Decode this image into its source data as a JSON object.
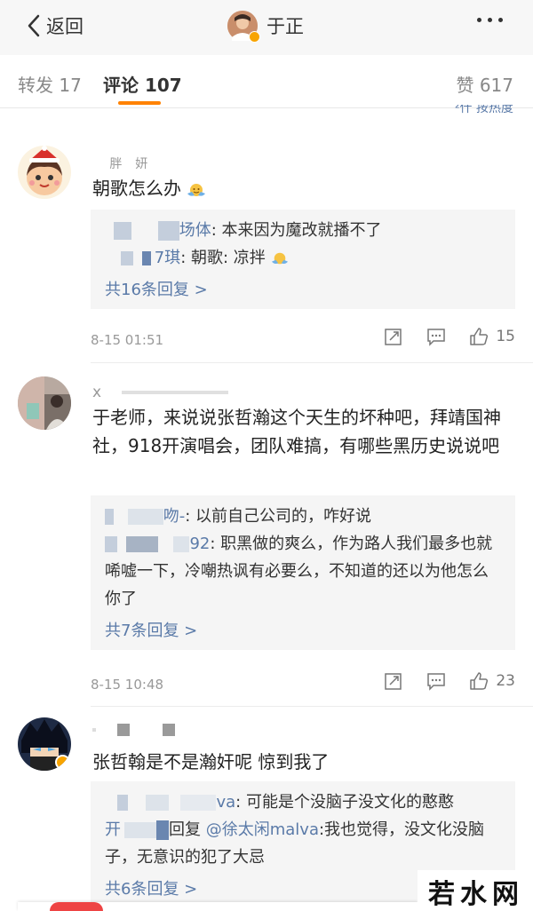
{
  "nav": {
    "back_label": "返回",
    "title": "于正"
  },
  "tabs": [
    {
      "label": "转发 17"
    },
    {
      "label": "评论 107"
    },
    {
      "label": "赞 617"
    }
  ],
  "cutoff_text": "²什 按热度",
  "comments": [
    {
      "username": "   胖  妍",
      "text": "朝歌怎么办",
      "emoji": "hug-emoji",
      "replies": [
        {
          "name": "场体",
          "text": ": 本来因为魔改就播不了"
        },
        {
          "name": "7琪",
          "text": ": 朝歌: 凉拌"
        }
      ],
      "more": "共16条回复 >",
      "date": "8-15 01:51",
      "likes": "15"
    },
    {
      "username": "x",
      "text": "于老师，来说说张哲瀚这个天生的坏种吧，拜靖国神社，918开演唱会，团队难搞，有哪些黑历史说说吧",
      "replies": [
        {
          "name": "吻-",
          "text": ": 以前自己公司的，咋好说"
        },
        {
          "name": "92",
          "text": ": 职黑做的爽么，作为路人我们最多也就唏嘘一下，冷嘲热讽有必要么，不知道的还以为他怎么你了"
        }
      ],
      "more": "共7条回复 >",
      "date": "8-15 10:48",
      "likes": "23"
    },
    {
      "username": "",
      "text": "张哲翰是不是瀚奸呢 惊到我了",
      "replies": [
        {
          "name": "va",
          "text": ": 可能是个没脑子没文化的憨憨"
        },
        {
          "name": "开",
          "text": "回复",
          "mention": "@徐太闲malva",
          "tail": ":我也觉得，没文化没脑子，无意识的犯了大忌"
        }
      ],
      "more": "共6条回复 >"
    }
  ],
  "watermark": "若水网",
  "colors": {
    "accent": "#ff8200",
    "link": "#5a7aa8",
    "verified": "#f8a400"
  }
}
